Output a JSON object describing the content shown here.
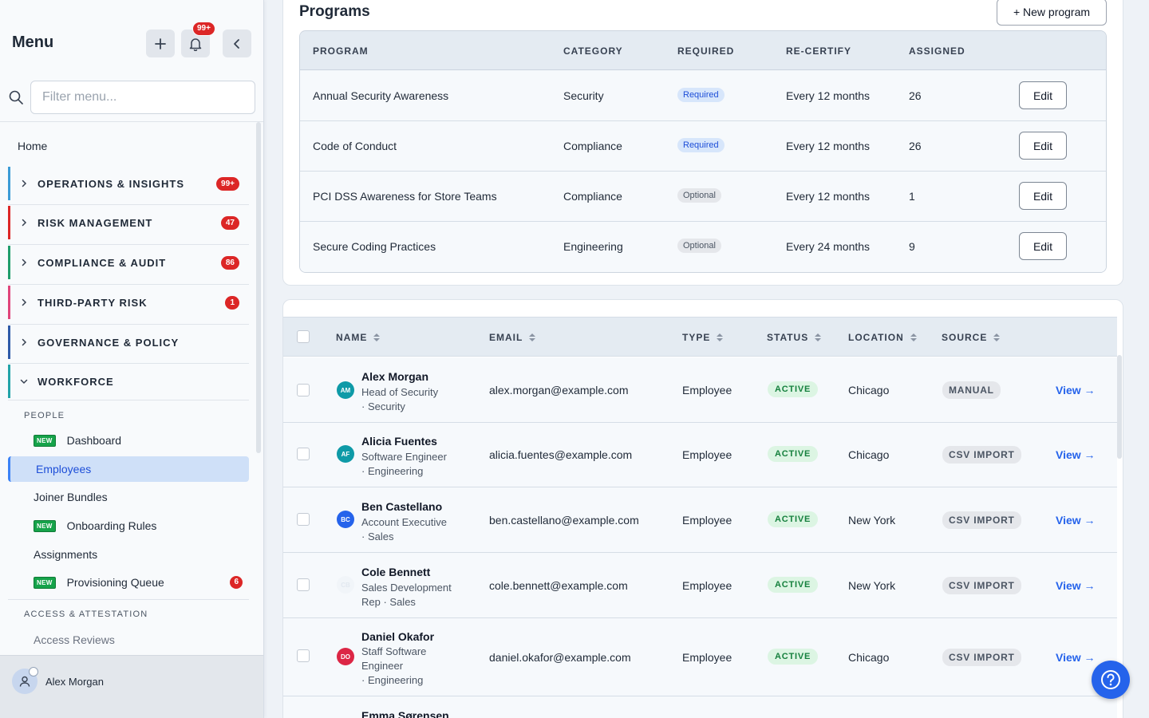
{
  "sidebar": {
    "title": "Menu",
    "notification_count": "99+",
    "search_placeholder": "Filter menu...",
    "home": "Home",
    "sections": [
      {
        "label": "OPERATIONS & INSIGHTS",
        "badge": "99+",
        "color": "#3b9bd6"
      },
      {
        "label": "RISK MANAGEMENT",
        "badge": "47",
        "color": "#dc2626"
      },
      {
        "label": "COMPLIANCE & AUDIT",
        "badge": "86",
        "color": "#1f9d6b"
      },
      {
        "label": "THIRD-PARTY RISK",
        "badge": "1",
        "color": "#e0457b"
      },
      {
        "label": "GOVERNANCE & POLICY",
        "badge": "",
        "color": "#2e5aa8"
      },
      {
        "label": "WORKFORCE",
        "badge": "",
        "color": "#22a3a8"
      }
    ],
    "people_heading": "PEOPLE",
    "items": [
      {
        "label": "Dashboard",
        "new": "NEW"
      },
      {
        "label": "Employees"
      },
      {
        "label": "Joiner Bundles"
      },
      {
        "label": "Onboarding Rules",
        "new": "NEW"
      },
      {
        "label": "Assignments"
      },
      {
        "label": "Provisioning Queue",
        "new": "NEW",
        "badge": "6"
      }
    ],
    "access_heading": "ACCESS & ATTESTATION",
    "access_items": [
      {
        "label": "Access Reviews"
      }
    ],
    "footer_user": "Alex Morgan"
  },
  "programs": {
    "title": "Programs",
    "new_button": "+ New program",
    "headers": {
      "program": "PROGRAM",
      "category": "CATEGORY",
      "required": "REQUIRED",
      "recertify": "RE-CERTIFY",
      "assigned": "ASSIGNED"
    },
    "edit_label": "Edit",
    "rows": [
      {
        "program": "Annual Security Awareness",
        "category": "Security",
        "required": "Required",
        "recertify": "Every 12 months",
        "assigned": "26"
      },
      {
        "program": "Code of Conduct",
        "category": "Compliance",
        "required": "Required",
        "recertify": "Every 12 months",
        "assigned": "26"
      },
      {
        "program": "PCI DSS Awareness for Store Teams",
        "category": "Compliance",
        "required": "Optional",
        "recertify": "Every 12 months",
        "assigned": "1"
      },
      {
        "program": "Secure Coding Practices",
        "category": "Engineering",
        "required": "Optional",
        "recertify": "Every 24 months",
        "assigned": "9"
      }
    ]
  },
  "employees": {
    "headers": {
      "name": "NAME",
      "email": "EMAIL",
      "type": "TYPE",
      "status": "STATUS",
      "location": "LOCATION",
      "source": "SOURCE"
    },
    "view_label": "View →",
    "rows": [
      {
        "initials": "AM",
        "avatar_color": "#0e9aa7",
        "name": "Alex Morgan",
        "role_line1": "Head of Security",
        "role_line2": "· Security",
        "role_line3": "",
        "email": "alex.morgan@example.com",
        "type": "Employee",
        "status": "ACTIVE",
        "location": "Chicago",
        "source": "MANUAL"
      },
      {
        "initials": "AF",
        "avatar_color": "#0e9aa7",
        "name": "Alicia Fuentes",
        "role_line1": "Software Engineer",
        "role_line2": "· Engineering",
        "role_line3": "",
        "email": "alicia.fuentes@example.com",
        "type": "Employee",
        "status": "ACTIVE",
        "location": "Chicago",
        "source": "CSV IMPORT"
      },
      {
        "initials": "BC",
        "avatar_color": "#2563eb",
        "name": "Ben Castellano",
        "role_line1": "Account Executive",
        "role_line2": "· Sales",
        "role_line3": "",
        "email": "ben.castellano@example.com",
        "type": "Employee",
        "status": "ACTIVE",
        "location": "New York",
        "source": "CSV IMPORT"
      },
      {
        "initials": "CB",
        "avatar_color": "#f1f5f9",
        "name": "Cole Bennett",
        "role_line1": "Sales Development",
        "role_line2": "Rep · Sales",
        "role_line3": "",
        "email": "cole.bennett@example.com",
        "type": "Employee",
        "status": "ACTIVE",
        "location": "New York",
        "source": "CSV IMPORT"
      },
      {
        "initials": "DO",
        "avatar_color": "#dc2645",
        "name": "Daniel Okafor",
        "role_line1": "Staff Software",
        "role_line2": "Engineer",
        "role_line3": "· Engineering",
        "email": "daniel.okafor@example.com",
        "type": "Employee",
        "status": "ACTIVE",
        "location": "Chicago",
        "source": "CSV IMPORT"
      },
      {
        "initials": "",
        "avatar_color": "",
        "name": "Emma Sørensen",
        "role_line1": "",
        "role_line2": "",
        "role_line3": "",
        "email": "",
        "type": "",
        "status": "",
        "location": "",
        "source": ""
      }
    ]
  }
}
